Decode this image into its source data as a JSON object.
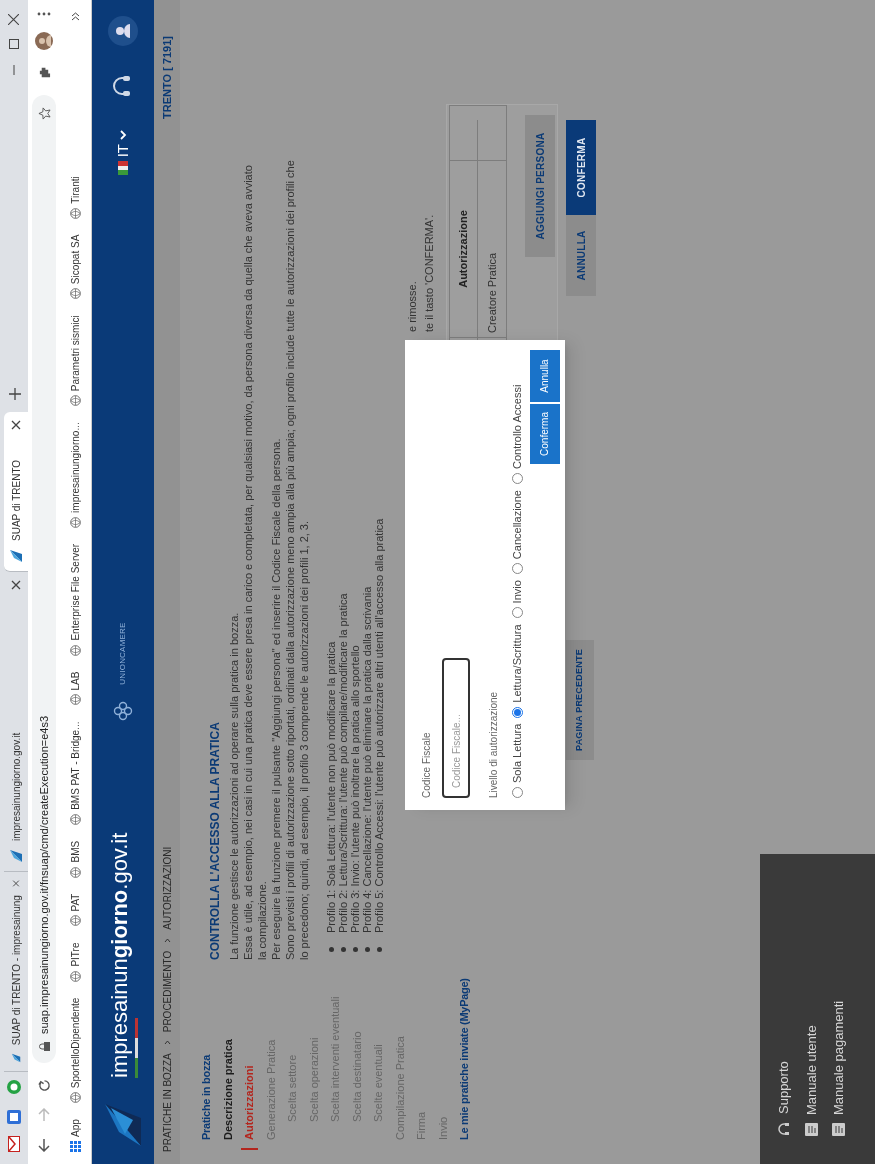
{
  "browser": {
    "tabs": [
      {
        "title": "SUAP di TRENTO - impresainung",
        "selected": false
      },
      {
        "title": "impresainungiorno.gov.it",
        "selected": false
      },
      {
        "title": "SUAP di TRENTO",
        "selected": true
      }
    ],
    "address": "suap.impresainungiorno.gov.it/fnsuap/cmd/createExecution=e4s3",
    "bookmarks": [
      {
        "kind": "apps",
        "label": "App"
      },
      {
        "kind": "link",
        "label": "SportelloDipendente"
      },
      {
        "kind": "link",
        "label": "PITre"
      },
      {
        "kind": "link",
        "label": "PAT"
      },
      {
        "kind": "link",
        "label": "BMS"
      },
      {
        "kind": "link",
        "label": "BMS PAT - Bridge..."
      },
      {
        "kind": "link",
        "label": "LAB"
      },
      {
        "kind": "link",
        "label": "Enterprise File Server"
      },
      {
        "kind": "link",
        "label": "impresainungiorno..."
      },
      {
        "kind": "link",
        "label": "Parametri sismici"
      },
      {
        "kind": "link",
        "label": "Sicopat SA"
      },
      {
        "kind": "link",
        "label": "Tiranti"
      }
    ]
  },
  "header": {
    "logo": "impresainun**giorno**.gov.it",
    "partner": "UNIONCAMERE",
    "language": "IT"
  },
  "breadcrumb": [
    "PRATICHE IN BOZZA",
    "PROCEDIMENTO",
    "AUTORIZZAZIONI"
  ],
  "location": "TRENTO [ 7191]",
  "sidebar": [
    {
      "kind": "section",
      "label": "Pratiche in bozza",
      "selected": false
    },
    {
      "kind": "done",
      "label": "Descrizione pratica",
      "selected": false
    },
    {
      "kind": "current",
      "label": "Autorizzazioni",
      "selected": true
    },
    {
      "kind": "step",
      "label": "Generazione Pratica",
      "selected": false,
      "children": [
        {
          "kind": "step",
          "label": "Scelta settore",
          "selected": false
        },
        {
          "kind": "step",
          "label": "Scelta operazioni",
          "selected": false
        },
        {
          "kind": "step",
          "label": "Scelta interventi eventuali",
          "selected": false
        },
        {
          "kind": "step",
          "label": "Scelta destinatario",
          "selected": false
        },
        {
          "kind": "step",
          "label": "Scelte eventuali",
          "selected": false
        }
      ]
    },
    {
      "kind": "step",
      "label": "Compilazione Pratica",
      "selected": false
    },
    {
      "kind": "step",
      "label": "Firma",
      "selected": false
    },
    {
      "kind": "step",
      "label": "Invio",
      "selected": false
    },
    {
      "kind": "section",
      "label": "Le mie pratiche inviate (MyPage)",
      "selected": false
    }
  ],
  "content": {
    "title": "CONTROLLA L'ACCESSO ALLA PRATICA",
    "paragraphs": [
      "La funzione gestisce le autorizzazioni ad operare sulla pratica in bozza.",
      "Essa è utile, ad esempio, nei casi in cui una pratica deve essere presa in carico e completata, per qualsiasi motivo, da persona diversa da quella che aveva avviato la compilazione.",
      "Per eseguire la funzione premere il pulsante \"Aggiungi persona\" ed inserire il Codice Fiscale della persona.",
      "Sono previsti i profili di autorizzazione sotto riportati, ordinati dalla autorizzazione meno ampia alla più ampia; ogni profilo include tutte le autorizzazioni dei profili che lo precedono; quindi, ad esempio, il profilo 3 comprende le autorizzazioni dei profili 1, 2, 3."
    ],
    "profiles": [
      "Profilo 1: Sola Lettura: l'utente non può modificare la pratica",
      "Profilo 2: Lettura/Scrittura: l'utente può compilare/modificare la pratica",
      "Profilo 3: Invio: l'utente può inoltrare la pratica allo sportello",
      "Profilo 4: Cancellazione: l'utente può eliminare la pratica dalla scrivania",
      "Profilo 5: Controllo Accessi: l'utente può autorizzare altri utenti all'accesso alla pratica"
    ],
    "partial_lines": [
      "e rimosse.",
      "te il tasto 'CONFERMA'."
    ]
  },
  "table": {
    "header": "Autorizzazione",
    "cell": "Creatore Pratica"
  },
  "add_button": "AGGIUNGI PERSONA",
  "buttons": {
    "back": "PAGINA PRECEDENTE",
    "cancel": "ANNULLA",
    "confirm": "CONFERMA"
  },
  "footer": [
    "Supporto",
    "Manuale utente",
    "Manuale pagamenti"
  ],
  "modal": {
    "field_label": "Codice Fiscale",
    "placeholder": "Codice Fiscale...",
    "level_label": "Livello di autorizzazione",
    "options": [
      {
        "label": "Sola Lettura",
        "selected": false
      },
      {
        "label": "Lettura/Scrittura",
        "selected": true
      },
      {
        "label": "Invio",
        "selected": false
      },
      {
        "label": "Cancellazione",
        "selected": false
      },
      {
        "label": "Controllo Accessi",
        "selected": false
      }
    ],
    "confirm": "Conferma",
    "cancel": "Annulla"
  }
}
